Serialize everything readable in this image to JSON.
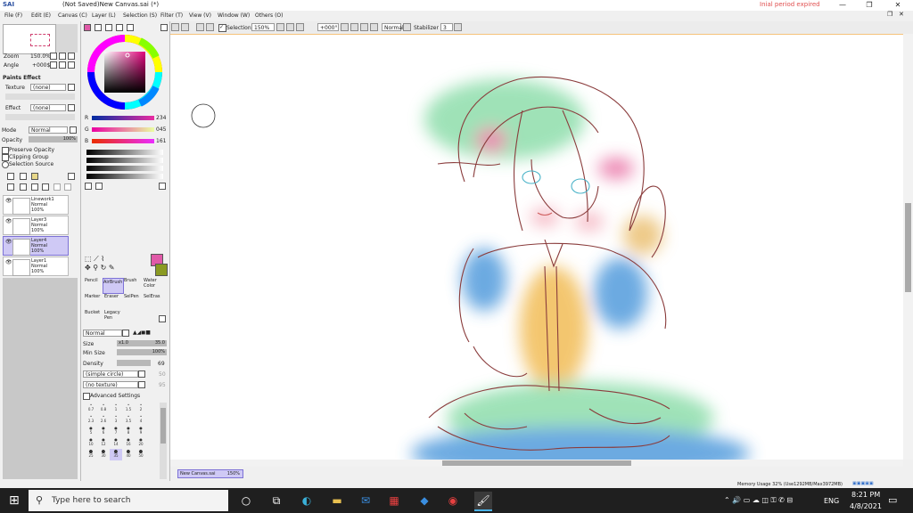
{
  "window": {
    "app_logo_text": "SAI",
    "title": "(Not Saved)New Canvas.sai (*)",
    "trial_notice": "Inial period expired",
    "minimize": "—",
    "maximize": "❐",
    "close": "✕"
  },
  "menu": [
    "File (F)",
    "Edit (E)",
    "Canvas (C)",
    "Layer (L)",
    "Selection (S)",
    "Filter (T)",
    "View (V)",
    "Window (W)",
    "Others (O)"
  ],
  "toolbar": {
    "selection_label": "Selection",
    "zoom": "150%",
    "rotation": "+000°",
    "blend": "Normal",
    "stabilizer_label": "Stabilizer",
    "stabilizer_value": "3"
  },
  "navigator": {
    "zoom_label": "Zoom",
    "zoom_value": "150.0%",
    "angle_label": "Angle",
    "angle_value": "+000$"
  },
  "paint_effect": {
    "header": "Paints Effect",
    "texture_label": "Texture",
    "texture_value": "(none)",
    "effect_label": "Effect",
    "effect_value": "(none)",
    "mode_label": "Mode",
    "mode_value": "Normal",
    "opacity_label": "Opacity",
    "opacity_value": "100%",
    "preserve_opacity": "Preserve Opacity",
    "clipping_group": "Clipping Group",
    "selection_source": "Selection Source"
  },
  "layers": [
    {
      "name": "Linework1",
      "mode": "Normal",
      "opacity": "100%",
      "selected": false
    },
    {
      "name": "Layer3",
      "mode": "Normal",
      "opacity": "100%",
      "selected": false
    },
    {
      "name": "Layer4",
      "mode": "Normal",
      "opacity": "100%",
      "selected": true
    },
    {
      "name": "Layer1",
      "mode": "Normal",
      "opacity": "100%",
      "selected": false
    }
  ],
  "color": {
    "r_label": "R",
    "r_value": "234",
    "g_label": "G",
    "g_value": "045",
    "b_label": "B",
    "b_value": "161",
    "primary": "#e05aa8",
    "secondary": "#8a9a22"
  },
  "tools": {
    "pencil": "Pencil",
    "airbrush": "AirBrush",
    "brush": "Brush",
    "water": "Water Color",
    "marker": "Marker",
    "eraser": "Eraser",
    "selpen": "SelPen",
    "seleras": "SelEras",
    "bucket": "Bucket",
    "legacy": "Legacy Pen"
  },
  "brush_settings": {
    "blend": "Normal",
    "size_label": "Size",
    "size_mult": "x1.0",
    "size_value": "35.0",
    "min_size_label": "Min Size",
    "min_size_value": "100%",
    "density_label": "Density",
    "density_value": "69",
    "shape_value": "(simple circle)",
    "shape_num": "50",
    "texture_value": "(no texture)",
    "texture_num": "95",
    "advanced": "Advanced Settings"
  },
  "brush_sizes": [
    [
      "0.7",
      "0.8",
      "1",
      "1.5",
      "2"
    ],
    [
      "2.3",
      "2.6",
      "3",
      "3.5",
      "4"
    ],
    [
      "5",
      "6",
      "7",
      "8",
      "9"
    ],
    [
      "10",
      "12",
      "14",
      "16",
      "20"
    ],
    [
      "25",
      "30",
      "35",
      "40",
      "50"
    ]
  ],
  "document_tab": {
    "name": "New Canvas.sai",
    "zoom": "150%"
  },
  "status": {
    "memory": "Memory Usage 32% (Use1292MB/Max3972MB)"
  },
  "taskbar": {
    "search_placeholder": "Type here to search",
    "language": "ENG",
    "time": "8:21 PM",
    "date": "4/8/2021"
  }
}
